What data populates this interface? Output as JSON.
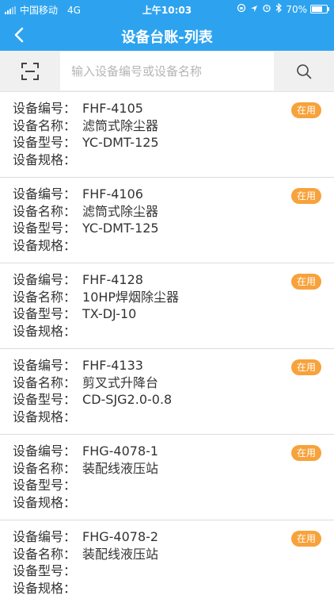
{
  "status_bar": {
    "carrier": "中国移动",
    "network": "4G",
    "time": "上午10:03",
    "battery": "70%",
    "battery_level": 0.7,
    "icons": [
      "signal-icon",
      "lock-rotation-icon",
      "location-icon",
      "alarm-icon",
      "bluetooth-icon",
      "battery-icon"
    ]
  },
  "header": {
    "title": "设备台账-列表",
    "back_icon": "chevron-left-icon"
  },
  "search": {
    "placeholder": "输入设备编号或设备名称",
    "value": "",
    "scan_icon": "scan-icon",
    "search_icon": "search-icon"
  },
  "labels": {
    "code": "设备编号：",
    "name": "设备名称：",
    "model": "设备型号：",
    "spec": "设备规格："
  },
  "equipment": [
    {
      "code": "FHF-4105",
      "name": "滤筒式除尘器",
      "model": "YC-DMT-125",
      "spec": "",
      "status": "在用"
    },
    {
      "code": "FHF-4106",
      "name": "滤筒式除尘器",
      "model": "YC-DMT-125",
      "spec": "",
      "status": "在用"
    },
    {
      "code": "FHF-4128",
      "name": "10HP焊烟除尘器",
      "model": "TX-DJ-10",
      "spec": "",
      "status": "在用"
    },
    {
      "code": "FHF-4133",
      "name": "剪叉式升降台",
      "model": "CD-SJG2.0-0.8",
      "spec": "",
      "status": "在用"
    },
    {
      "code": "FHG-4078-1",
      "name": "装配线液压站",
      "model": "",
      "spec": "",
      "status": "在用"
    },
    {
      "code": "FHG-4078-2",
      "name": "装配线液压站",
      "model": "",
      "spec": "",
      "status": "在用"
    }
  ],
  "colors": {
    "primary": "#2da3f0",
    "badge": "#f7a23b",
    "search_bg": "#f0f0f0",
    "text": "#333333",
    "divider": "#dcdcdc"
  }
}
